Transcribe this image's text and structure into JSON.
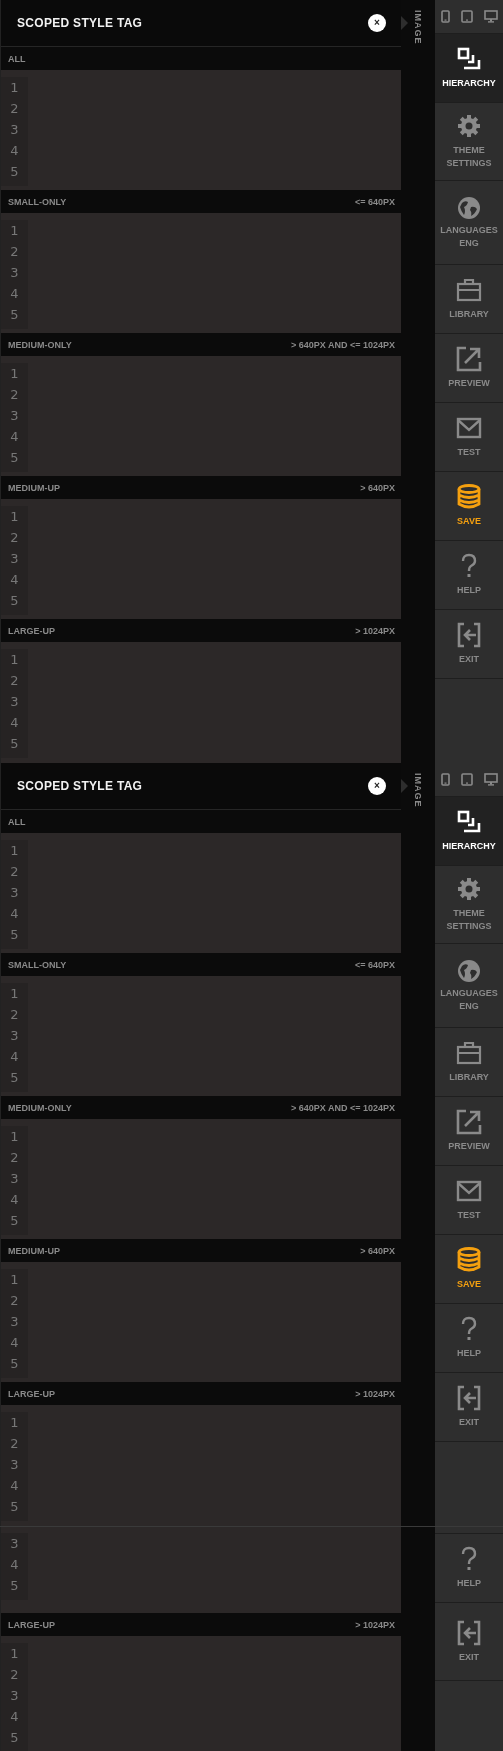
{
  "frames": [
    {
      "kind": "full",
      "panel": {
        "title": "SCOPED STYLE TAG",
        "close": "×",
        "sections": [
          {
            "label": "ALL",
            "lines": [
              "1",
              "2",
              "3",
              "4",
              "5"
            ]
          },
          {
            "label": "SMALL-ONLY",
            "aside": "<= 640PX",
            "lines": [
              "1",
              "2",
              "3",
              "4",
              "5"
            ]
          },
          {
            "label": "MEDIUM-ONLY",
            "aside": "> 640PX AND <= 1024PX",
            "lines": [
              "1",
              "2",
              "3",
              "4",
              "5"
            ]
          },
          {
            "label": "MEDIUM-UP",
            "aside": "> 640PX",
            "lines": [
              "1",
              "2",
              "3",
              "4",
              "5"
            ]
          },
          {
            "label": "LARGE-UP",
            "aside": "> 1024PX",
            "lines": [
              "1",
              "2",
              "3",
              "4",
              "5"
            ]
          }
        ]
      },
      "tab": "IMAGE",
      "devices": true,
      "nav": [
        {
          "kind": "hierarchy",
          "label": "HIERARCHY",
          "selected": true,
          "accent": false
        },
        {
          "kind": "gear",
          "label": "THEME SETTINGS",
          "selected": false,
          "accent": false
        },
        {
          "kind": "globe",
          "label": "LANGUAGES",
          "value": "ENG",
          "selected": false,
          "accent": false
        },
        {
          "kind": "briefcase",
          "label": "LIBRARY",
          "selected": false,
          "accent": false
        },
        {
          "kind": "external",
          "label": "PREVIEW",
          "selected": false,
          "accent": false
        },
        {
          "kind": "envelope",
          "label": "TEST",
          "selected": false,
          "accent": false
        },
        {
          "kind": "database",
          "label": "SAVE",
          "selected": false,
          "accent": true
        },
        {
          "kind": "question",
          "label": "HELP",
          "selected": false,
          "accent": false
        },
        {
          "kind": "exit",
          "label": "EXIT",
          "selected": false,
          "accent": false
        }
      ]
    },
    {
      "kind": "full",
      "panel": {
        "title": "SCOPED STYLE TAG",
        "close": "×",
        "sections": [
          {
            "label": "ALL",
            "lines": [
              "1",
              "2",
              "3",
              "4",
              "5"
            ]
          },
          {
            "label": "SMALL-ONLY",
            "aside": "<= 640PX",
            "lines": [
              "1",
              "2",
              "3",
              "4",
              "5"
            ]
          },
          {
            "label": "MEDIUM-ONLY",
            "aside": "> 640PX AND <= 1024PX",
            "lines": [
              "1",
              "2",
              "3",
              "4",
              "5"
            ]
          },
          {
            "label": "MEDIUM-UP",
            "aside": "> 640PX",
            "lines": [
              "1",
              "2",
              "3",
              "4",
              "5"
            ]
          },
          {
            "label": "LARGE-UP",
            "aside": "> 1024PX",
            "lines": [
              "1",
              "2",
              "3",
              "4",
              "5"
            ]
          }
        ]
      },
      "tab": "IMAGE",
      "devices": true,
      "nav": [
        {
          "kind": "hierarchy",
          "label": "HIERARCHY",
          "selected": true,
          "accent": false
        },
        {
          "kind": "gear",
          "label": "THEME SETTINGS",
          "selected": false,
          "accent": false
        },
        {
          "kind": "globe",
          "label": "LANGUAGES",
          "value": "ENG",
          "selected": false,
          "accent": false
        },
        {
          "kind": "briefcase",
          "label": "LIBRARY",
          "selected": false,
          "accent": false
        },
        {
          "kind": "external",
          "label": "PREVIEW",
          "selected": false,
          "accent": false
        },
        {
          "kind": "envelope",
          "label": "TEST",
          "selected": false,
          "accent": false
        },
        {
          "kind": "database",
          "label": "SAVE",
          "selected": false,
          "accent": true
        },
        {
          "kind": "question",
          "label": "HELP",
          "selected": false,
          "accent": false
        },
        {
          "kind": "exit",
          "label": "EXIT",
          "selected": false,
          "accent": false
        }
      ]
    },
    {
      "kind": "tail",
      "panel": {
        "sections": [
          {
            "lines": [
              "3",
              "4",
              "5"
            ]
          },
          {
            "label": "LARGE-UP",
            "aside": "> 1024PX",
            "lines": [
              "1",
              "2",
              "3",
              "4",
              "5"
            ]
          }
        ]
      },
      "nav": [
        {
          "kind": "question",
          "label": "HELP",
          "selected": false,
          "accent": false
        },
        {
          "kind": "exit",
          "label": "EXIT",
          "selected": false,
          "accent": false
        }
      ]
    }
  ]
}
